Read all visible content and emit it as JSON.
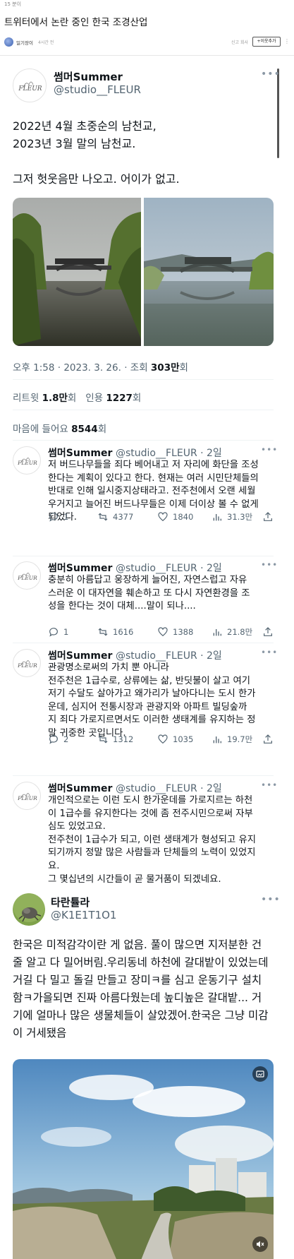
{
  "page": {
    "top_number": "15 분이",
    "title": "트위터에서 논란 중인 한국 조경산업",
    "author": "일기장이",
    "age": "4시간 전",
    "report": "신고 회사",
    "subscribe": "+이웃추가"
  },
  "main_tweet": {
    "name": "썸머Summer",
    "handle": "@studio__FLEUR",
    "avatar_text": "FLEUR",
    "text": "2022년 4월 초중순의 남천교,\n2023년 3월 말의 남천교.\n\n그저 헛웃음만 나오고. 어이가 없고.",
    "timestamp": "오후 1:58 · 2023. 3. 26. · 조회 ",
    "views_value": "303만",
    "views_suffix": "회",
    "retweets_label": "리트윗 ",
    "retweets_value": "1.8만",
    "retweets_unit": "회",
    "quotes_label": "인용 ",
    "quotes_value": "1227",
    "quotes_unit": "회",
    "likes_label": "마음에 들어요 ",
    "likes_value": "8544",
    "likes_unit": "회"
  },
  "replies": [
    {
      "name": "썸머Summer",
      "handle": "@studio__FLEUR · 2일",
      "text": "저 버드나무들을 죄다 베어내고 저 자리에 화단을 조성\n한다는 계획이 있다고 한다. 현재는 여러 시민단체들의\n반대로 인해 일시중지상태라고. 전주천에서 오랜 세월\n우거지고 늘어진 버드나무들은 이제 더이상 볼 수 없게\n되었다.",
      "replies": "1",
      "retweets": "4377",
      "likes": "1840",
      "views": "31.3만"
    },
    {
      "name": "썸머Summer",
      "handle": "@studio__FLEUR · 2일",
      "text": "충분히 아름답고 웅장하게 늘어진, 자연스럽고 자유\n스러운 이 대자연을 훼손하고 또 다시 자연환경을 조\n성을 한다는 것이 대체....말이 되나....",
      "replies": "1",
      "retweets": "1616",
      "likes": "1388",
      "views": "21.8만"
    },
    {
      "name": "썸머Summer",
      "handle": "@studio__FLEUR · 2일",
      "text": "관광명소로써의 가치 뿐 아니라\n전주천은 1급수로, 상류에는 삶, 반딧불이 살고 여기\n저기 수달도 살아가고 왜가리가 날아다니는 도시 한가\n운데, 심지어 전통시장과 관광지와 아파트 빌딩숲까\n지 죄다 가로지르면서도 이러한 생태계를 유지하는 정\n말 귀중한 곳입니다.",
      "replies": "2",
      "retweets": "1312",
      "likes": "1035",
      "views": "19.7만"
    },
    {
      "name": "썸머Summer",
      "handle": "@studio__FLEUR · 2일",
      "text": "개인적으로는 이런 도시 한가운데를 가로지르는 하천\n이 1급수를 유지한다는 것에 좀 전주시민으로써 자부\n심도 있었고요.\n전주천이 1급수가 되고, 이런 생태계가 형성되고 유지\n되기까지 정말 많은 사람들과 단체들의 노력이 있었지\n요.\n그 몇십년의 시간들이 곧 물거품이 되겠네요."
    }
  ],
  "second_tweet": {
    "name": "타란튤라",
    "handle": "@K1E1T1O1",
    "text": "한국은 미적감각이란 게 없음. 풀이 많으면 지저분한 건\n줄 알고 다 밀어버림.우리동네 하천에 갈대밭이 있었는데\n거길 다 밀고 돌길 만들고 장미ㅋ를 심고 운동기구 설치\n함ㅋ가을되면 진짜 아름다웠는데 높디높은 갈대밭... 거\n기에 얼마나 많은 생물체들이 살았겠어.한국은 그냥 미감\n이 거세됐음"
  },
  "icons": [
    "reply-icon",
    "retweet-icon",
    "heart-icon",
    "views-icon",
    "share-icon",
    "mute-icon",
    "gif-icon"
  ],
  "colors": {
    "text": "#0f1419",
    "muted": "#536471",
    "divider": "#eff3f4"
  }
}
